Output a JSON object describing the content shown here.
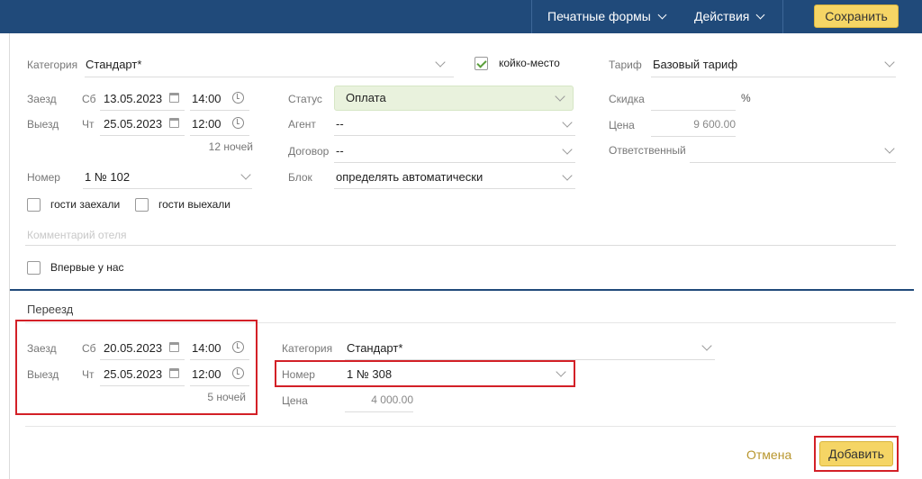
{
  "topbar": {
    "print_forms": "Печатные формы",
    "actions": "Действия",
    "save": "Сохранить"
  },
  "booking": {
    "category_label": "Категория",
    "category_value": "Стандарт*",
    "bed_place_label": "койко-место",
    "bed_place_checked": true,
    "tariff_label": "Тариф",
    "tariff_value": "Базовый тариф",
    "checkin_label": "Заезд",
    "checkin_day": "Сб",
    "checkin_date": "13.05.2023",
    "checkin_time": "14:00",
    "checkout_label": "Выезд",
    "checkout_day": "Чт",
    "checkout_date": "25.05.2023",
    "checkout_time": "12:00",
    "nights": "12 ночей",
    "status_label": "Статус",
    "status_value": "Оплата",
    "agent_label": "Агент",
    "agent_value": "--",
    "contract_label": "Договор",
    "contract_value": "--",
    "block_label": "Блок",
    "block_value": "определять автоматически",
    "discount_label": "Скидка",
    "discount_unit": "%",
    "price_label": "Цена",
    "price_value": "9 600.00",
    "responsible_label": "Ответственный",
    "room_label": "Номер",
    "room_value": "1 № 102",
    "guests_checked_in": "гости заехали",
    "guests_checked_out": "гости выехали",
    "comment_placeholder": "Комментарий отеля",
    "first_time": "Впервые у нас"
  },
  "move": {
    "section_title": "Переезд",
    "checkin_label": "Заезд",
    "checkin_day": "Сб",
    "checkin_date": "20.05.2023",
    "checkin_time": "14:00",
    "checkout_label": "Выезд",
    "checkout_day": "Чт",
    "checkout_date": "25.05.2023",
    "checkout_time": "12:00",
    "nights": "5 ночей",
    "category_label": "Категория",
    "category_value": "Стандарт*",
    "room_label": "Номер",
    "room_value": "1 № 308",
    "price_label": "Цена",
    "price_value": "4 000.00"
  },
  "footer": {
    "cancel": "Отмена",
    "add": "Добавить"
  },
  "colors": {
    "topbar": "#204a7a",
    "accent_button": "#f5d565",
    "highlight_box": "#d32027",
    "status_bg": "#e9f2dd"
  }
}
